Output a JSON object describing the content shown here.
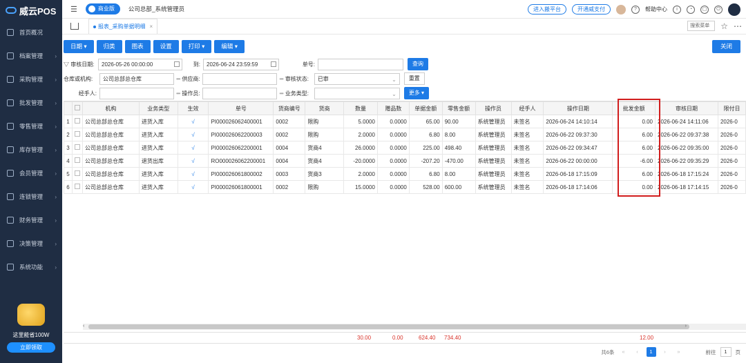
{
  "app": {
    "name": "威云POS"
  },
  "sidebar": {
    "items": [
      {
        "label": "首页概况"
      },
      {
        "label": "档案管理"
      },
      {
        "label": "采购管理"
      },
      {
        "label": "批发管理"
      },
      {
        "label": "零售管理"
      },
      {
        "label": "库存管理"
      },
      {
        "label": "会员管理"
      },
      {
        "label": "连锁管理"
      },
      {
        "label": "财务管理"
      },
      {
        "label": "决策管理"
      },
      {
        "label": "系统功能"
      }
    ],
    "promo_text": "这里能省100W",
    "promo_button": "立即领取"
  },
  "topbar": {
    "edition": "商业版",
    "user": "公司总部_系统管理员",
    "btn_platform": "进入搬平台",
    "btn_pay": "开通威支付",
    "help": "帮助中心"
  },
  "tabs": {
    "active": "报表_采购单据明细",
    "search_placeholder": "搜索菜单"
  },
  "toolbar": {
    "date": "日期",
    "group": "归类",
    "chart": "图表",
    "settings": "设置",
    "print": "打印",
    "edit": "编辑",
    "close": "关闭"
  },
  "filters": {
    "audit_date_label": "审核日期:",
    "date_from": "2026-05-26 00:00:00",
    "to_label": "到:",
    "date_to": "2026-06-24 23:59:59",
    "doc_no_label": "单号:",
    "query": "查询",
    "org_label": "仓库或机构:",
    "org_value": "公司总部总仓库",
    "supplier_label": "供应商:",
    "audit_status_label": "审核状态:",
    "audit_status_value": "已审",
    "reset": "重置",
    "handler_label": "经手人:",
    "operator_label": "操作员:",
    "biz_type_label": "业务类型:",
    "more": "更多"
  },
  "table": {
    "headers": [
      "机构",
      "业务类型",
      "生效",
      "单号",
      "货商编号",
      "货商",
      "数量",
      "赠品数",
      "单据金额",
      "零售金额",
      "操作员",
      "经手人",
      "操作日期",
      "批发金额",
      "审核日期",
      "限付日"
    ],
    "rows": [
      {
        "no": "1",
        "org": "公司总部总仓库",
        "type": "进货入库",
        "eff": "√",
        "doc": "PI000026062400001",
        "sup_no": "0002",
        "sup": "限购",
        "qty": "5.0000",
        "gift": "0.0000",
        "amt": "65.00",
        "retail": "90.00",
        "op": "系统管理员",
        "handler": "未签名",
        "op_date": "2026-06-24 14:10:14",
        "wholesale": "0.00",
        "audit_date": "2026-06-24 14:11:06",
        "limit": "2026-0"
      },
      {
        "no": "2",
        "org": "公司总部总仓库",
        "type": "进货入库",
        "eff": "√",
        "doc": "PI000026062200003",
        "sup_no": "0002",
        "sup": "限购",
        "qty": "2.0000",
        "gift": "0.0000",
        "amt": "6.80",
        "retail": "8.00",
        "op": "系统管理员",
        "handler": "未签名",
        "op_date": "2026-06-22 09:37:30",
        "wholesale": "6.00",
        "audit_date": "2026-06-22 09:37:38",
        "limit": "2026-0"
      },
      {
        "no": "3",
        "org": "公司总部总仓库",
        "type": "进货入库",
        "eff": "√",
        "doc": "PI000026062200001",
        "sup_no": "0004",
        "sup": "货商4",
        "qty": "26.0000",
        "gift": "0.0000",
        "amt": "225.00",
        "retail": "498.40",
        "op": "系统管理员",
        "handler": "未签名",
        "op_date": "2026-06-22 09:34:47",
        "wholesale": "6.00",
        "audit_date": "2026-06-22 09:35:00",
        "limit": "2026-0"
      },
      {
        "no": "4",
        "org": "公司总部总仓库",
        "type": "退货出库",
        "eff": "√",
        "doc": "RO000026062200001",
        "sup_no": "0004",
        "sup": "货商4",
        "qty": "-20.0000",
        "gift": "0.0000",
        "amt": "-207.20",
        "retail": "-470.00",
        "op": "系统管理员",
        "handler": "未签名",
        "op_date": "2026-06-22 00:00:00",
        "wholesale": "-6.00",
        "audit_date": "2026-06-22 09:35:29",
        "limit": "2026-0"
      },
      {
        "no": "5",
        "org": "公司总部总仓库",
        "type": "进货入库",
        "eff": "√",
        "doc": "PI000026061800002",
        "sup_no": "0003",
        "sup": "货商3",
        "qty": "2.0000",
        "gift": "0.0000",
        "amt": "6.80",
        "retail": "8.00",
        "op": "系统管理员",
        "handler": "未签名",
        "op_date": "2026-06-18 17:15:09",
        "wholesale": "6.00",
        "audit_date": "2026-06-18 17:15:24",
        "limit": "2026-0"
      },
      {
        "no": "6",
        "org": "公司总部总仓库",
        "type": "进货入库",
        "eff": "√",
        "doc": "PI000026061800001",
        "sup_no": "0002",
        "sup": "限购",
        "qty": "15.0000",
        "gift": "0.0000",
        "amt": "528.00",
        "retail": "600.00",
        "op": "系统管理员",
        "handler": "未签名",
        "op_date": "2026-06-18 17:14:06",
        "wholesale": "0.00",
        "audit_date": "2026-06-18 17:14:15",
        "limit": "2026-0"
      }
    ],
    "totals": {
      "qty": "30.00",
      "gift": "0.00",
      "amt": "624.40",
      "retail": "734.40",
      "wholesale": "12.00"
    }
  },
  "pager": {
    "total": "共6条",
    "current": "1",
    "goto_label": "前往",
    "goto_value": "1",
    "page_unit": "页"
  },
  "colors": {
    "primary": "#1e7be6",
    "sidebar": "#1f2d43",
    "highlight": "#d11c1c",
    "totals": "#d9342b"
  }
}
